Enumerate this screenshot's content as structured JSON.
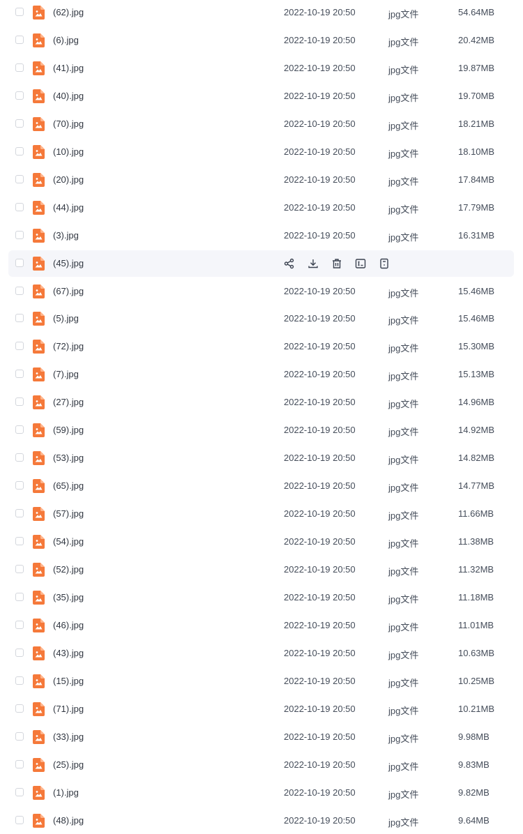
{
  "colors": {
    "icon_orange": "#f5793a",
    "hover_bg": "#f5f6fa",
    "text": "#454d5a"
  },
  "icons": {
    "file": "image-file-icon",
    "actions": [
      "share-icon",
      "download-icon",
      "delete-icon",
      "rename-icon",
      "more-icon"
    ]
  },
  "files": [
    {
      "name": "(62).jpg",
      "date": "2022-10-19 20:50",
      "type": "jpg文件",
      "size": "54.64MB"
    },
    {
      "name": "(6).jpg",
      "date": "2022-10-19 20:50",
      "type": "jpg文件",
      "size": "20.42MB"
    },
    {
      "name": "(41).jpg",
      "date": "2022-10-19 20:50",
      "type": "jpg文件",
      "size": "19.87MB"
    },
    {
      "name": "(40).jpg",
      "date": "2022-10-19 20:50",
      "type": "jpg文件",
      "size": "19.70MB"
    },
    {
      "name": "(70).jpg",
      "date": "2022-10-19 20:50",
      "type": "jpg文件",
      "size": "18.21MB"
    },
    {
      "name": "(10).jpg",
      "date": "2022-10-19 20:50",
      "type": "jpg文件",
      "size": "18.10MB"
    },
    {
      "name": "(20).jpg",
      "date": "2022-10-19 20:50",
      "type": "jpg文件",
      "size": "17.84MB"
    },
    {
      "name": "(44).jpg",
      "date": "2022-10-19 20:50",
      "type": "jpg文件",
      "size": "17.79MB"
    },
    {
      "name": "(3).jpg",
      "date": "2022-10-19 20:50",
      "type": "jpg文件",
      "size": "16.31MB"
    },
    {
      "name": "(45).jpg",
      "hovered": true
    },
    {
      "name": "(67).jpg",
      "date": "2022-10-19 20:50",
      "type": "jpg文件",
      "size": "15.46MB"
    },
    {
      "name": "(5).jpg",
      "date": "2022-10-19 20:50",
      "type": "jpg文件",
      "size": "15.46MB"
    },
    {
      "name": "(72).jpg",
      "date": "2022-10-19 20:50",
      "type": "jpg文件",
      "size": "15.30MB"
    },
    {
      "name": "(7).jpg",
      "date": "2022-10-19 20:50",
      "type": "jpg文件",
      "size": "15.13MB"
    },
    {
      "name": "(27).jpg",
      "date": "2022-10-19 20:50",
      "type": "jpg文件",
      "size": "14.96MB"
    },
    {
      "name": "(59).jpg",
      "date": "2022-10-19 20:50",
      "type": "jpg文件",
      "size": "14.92MB"
    },
    {
      "name": "(53).jpg",
      "date": "2022-10-19 20:50",
      "type": "jpg文件",
      "size": "14.82MB"
    },
    {
      "name": "(65).jpg",
      "date": "2022-10-19 20:50",
      "type": "jpg文件",
      "size": "14.77MB"
    },
    {
      "name": "(57).jpg",
      "date": "2022-10-19 20:50",
      "type": "jpg文件",
      "size": "11.66MB"
    },
    {
      "name": "(54).jpg",
      "date": "2022-10-19 20:50",
      "type": "jpg文件",
      "size": "11.38MB"
    },
    {
      "name": "(52).jpg",
      "date": "2022-10-19 20:50",
      "type": "jpg文件",
      "size": "11.32MB"
    },
    {
      "name": "(35).jpg",
      "date": "2022-10-19 20:50",
      "type": "jpg文件",
      "size": "11.18MB"
    },
    {
      "name": "(46).jpg",
      "date": "2022-10-19 20:50",
      "type": "jpg文件",
      "size": "11.01MB"
    },
    {
      "name": "(43).jpg",
      "date": "2022-10-19 20:50",
      "type": "jpg文件",
      "size": "10.63MB"
    },
    {
      "name": "(15).jpg",
      "date": "2022-10-19 20:50",
      "type": "jpg文件",
      "size": "10.25MB"
    },
    {
      "name": "(71).jpg",
      "date": "2022-10-19 20:50",
      "type": "jpg文件",
      "size": "10.21MB"
    },
    {
      "name": "(33).jpg",
      "date": "2022-10-19 20:50",
      "type": "jpg文件",
      "size": "9.98MB"
    },
    {
      "name": "(25).jpg",
      "date": "2022-10-19 20:50",
      "type": "jpg文件",
      "size": "9.83MB"
    },
    {
      "name": "(1).jpg",
      "date": "2022-10-19 20:50",
      "type": "jpg文件",
      "size": "9.82MB"
    },
    {
      "name": "(48).jpg",
      "date": "2022-10-19 20:50",
      "type": "jpg文件",
      "size": "9.64MB"
    }
  ]
}
